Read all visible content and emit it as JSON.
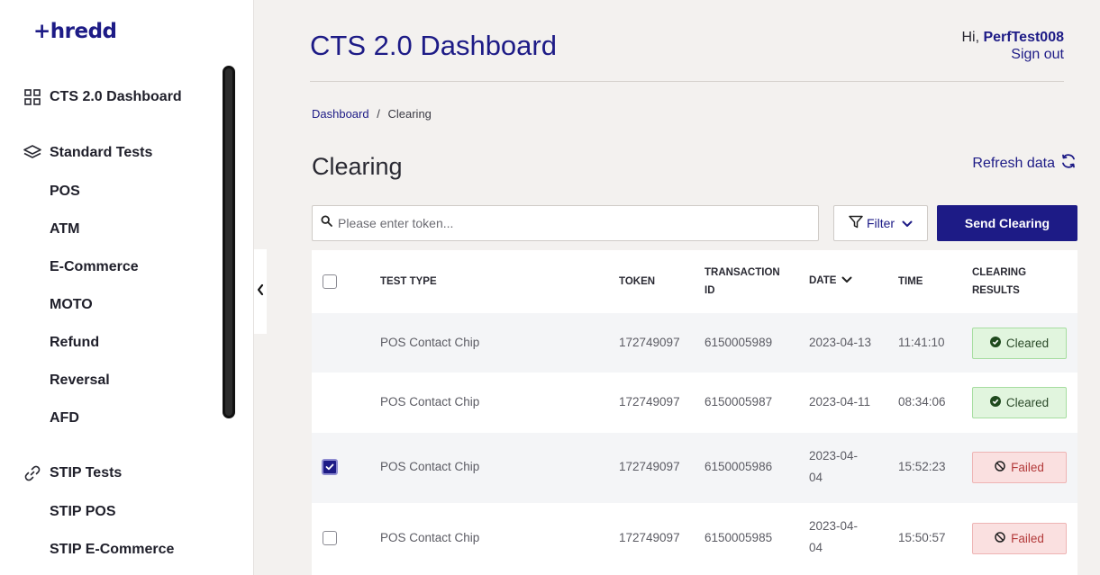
{
  "brand": {
    "logo": "+hredd"
  },
  "sidebar": {
    "items": [
      {
        "label": "CTS 2.0 Dashboard",
        "icon": "grid-icon"
      },
      {
        "label": "Standard Tests",
        "icon": "layers-icon"
      },
      {
        "label": "STIP Tests",
        "icon": "link-icon"
      }
    ],
    "standard_sub": [
      "POS",
      "ATM",
      "E-Commerce",
      "MOTO",
      "Refund",
      "Reversal",
      "AFD"
    ],
    "stip_sub": [
      "STIP POS",
      "STIP E-Commerce"
    ]
  },
  "header": {
    "title": "CTS 2.0 Dashboard",
    "greeting_prefix": "Hi, ",
    "user": "PerfTest008",
    "signout": "Sign out"
  },
  "breadcrumb": {
    "home": "Dashboard",
    "sep": "/",
    "current": "Clearing"
  },
  "main": {
    "title": "Clearing",
    "refresh_label": "Refresh data",
    "search_placeholder": "Please enter token...",
    "filter_label": "Filter",
    "send_label": "Send Clearing"
  },
  "table": {
    "headers": {
      "test_type": "TEST TYPE",
      "token": "TOKEN",
      "transaction_id_1": "TRANSACTION",
      "transaction_id_2": "ID",
      "date": "DATE",
      "time": "TIME",
      "clearing_1": "CLEARING",
      "clearing_2": "RESULTS"
    },
    "rows": [
      {
        "checked": false,
        "show_checkbox": false,
        "test_type": "POS Contact Chip",
        "token": "172749097",
        "txn": "6150005989",
        "date_1": "2023-04-13",
        "date_2": "",
        "time": "11:41:10",
        "result": "Cleared",
        "status": "ok"
      },
      {
        "checked": false,
        "show_checkbox": false,
        "test_type": "POS Contact Chip",
        "token": "172749097",
        "txn": "6150005987",
        "date_1": "2023-04-11",
        "date_2": "",
        "time": "08:34:06",
        "result": "Cleared",
        "status": "ok"
      },
      {
        "checked": true,
        "show_checkbox": true,
        "test_type": "POS Contact Chip",
        "token": "172749097",
        "txn": "6150005986",
        "date_1": "2023-04-",
        "date_2": "04",
        "time": "15:52:23",
        "result": "Failed",
        "status": "fail"
      },
      {
        "checked": false,
        "show_checkbox": true,
        "test_type": "POS Contact Chip",
        "token": "172749097",
        "txn": "6150005985",
        "date_1": "2023-04-",
        "date_2": "04",
        "time": "15:50:57",
        "result": "Failed",
        "status": "fail"
      }
    ]
  },
  "colors": {
    "brand": "#1d1b86",
    "ok_bg": "#e1f5de",
    "fail_bg": "#fae0e0"
  }
}
